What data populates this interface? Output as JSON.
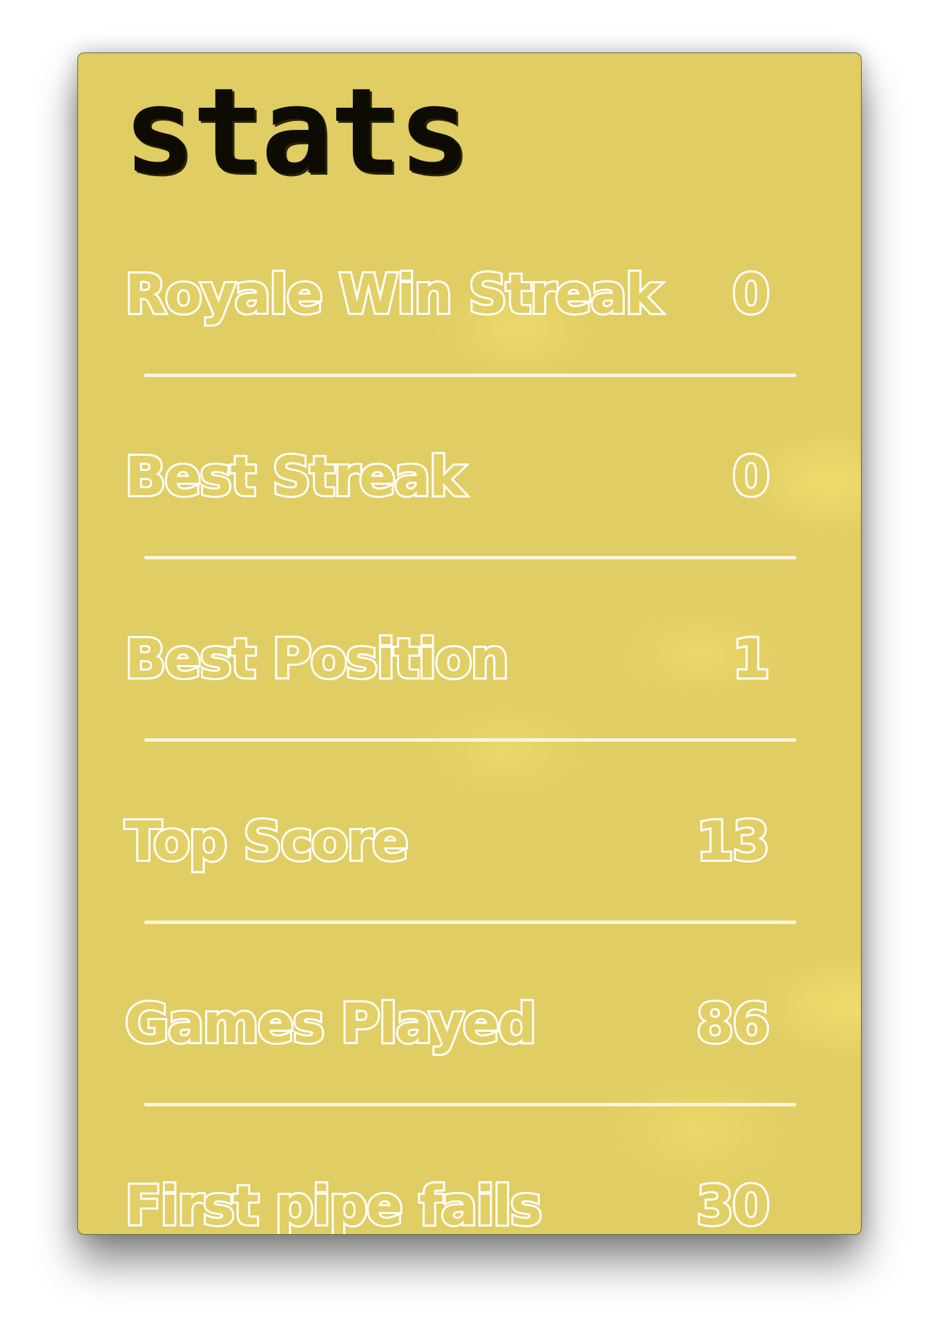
{
  "panel": {
    "title": "stats"
  },
  "stats": [
    {
      "label": "Royale Win Streak",
      "value": "0"
    },
    {
      "label": "Best Streak",
      "value": "0"
    },
    {
      "label": "Best Position",
      "value": "1"
    },
    {
      "label": "Top Score",
      "value": "13"
    },
    {
      "label": "Games Played",
      "value": "86"
    },
    {
      "label": "First pipe fails",
      "value": "30"
    }
  ],
  "colors": {
    "panel_background": "#e0cd63",
    "title_text": "#0d0b02",
    "stat_text_outline": "#ffffff",
    "divider": "#fbf5dc"
  }
}
